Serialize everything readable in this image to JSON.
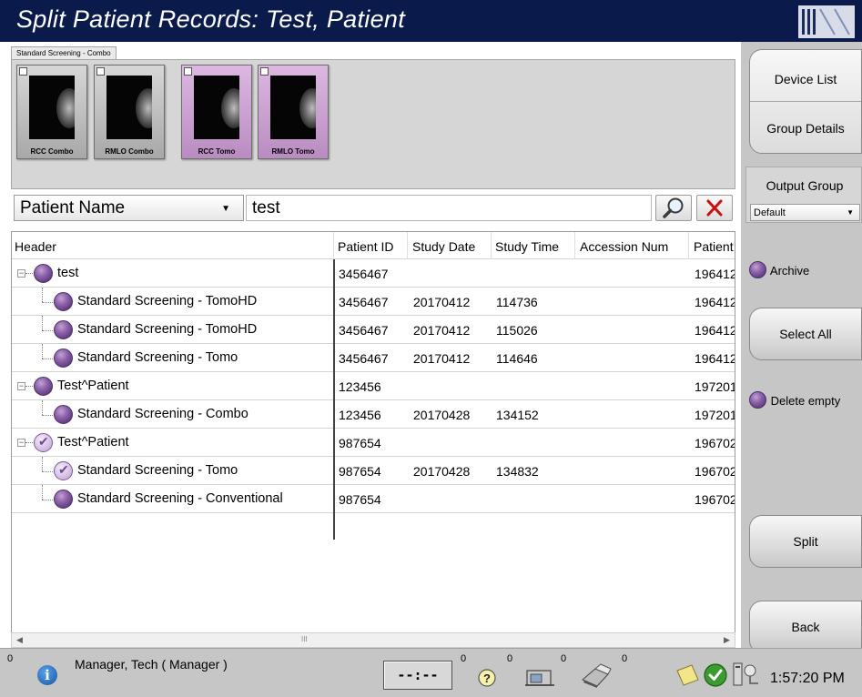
{
  "title": "Split Patient Records: Test, Patient",
  "thumbnails": {
    "tab_label": "Standard Screening - Combo",
    "items": [
      {
        "label": "RCC Combo",
        "selected": false
      },
      {
        "label": "RMLO Combo",
        "selected": false
      },
      {
        "label": "RCC Tomo",
        "selected": true
      },
      {
        "label": "RMLO Tomo",
        "selected": true
      }
    ]
  },
  "search": {
    "field": "Patient Name",
    "value": "test"
  },
  "table": {
    "columns": [
      "Header",
      "Patient ID",
      "Study Date",
      "Study Time",
      "Accession Num",
      "Patient"
    ],
    "rows": [
      {
        "level": 0,
        "name": "test",
        "checked": false,
        "patient_id": "3456467",
        "study_date": "",
        "study_time": "",
        "accession": "",
        "dob": "196412"
      },
      {
        "level": 1,
        "name": "Standard Screening - TomoHD",
        "checked": false,
        "patient_id": "3456467",
        "study_date": "20170412",
        "study_time": "114736",
        "accession": "",
        "dob": "196412"
      },
      {
        "level": 1,
        "name": "Standard Screening - TomoHD",
        "checked": false,
        "patient_id": "3456467",
        "study_date": "20170412",
        "study_time": "115026",
        "accession": "",
        "dob": "196412"
      },
      {
        "level": 1,
        "name": "Standard Screening - Tomo",
        "checked": false,
        "patient_id": "3456467",
        "study_date": "20170412",
        "study_time": "114646",
        "accession": "",
        "dob": "196412"
      },
      {
        "level": 0,
        "name": "Test^Patient",
        "checked": false,
        "patient_id": "123456",
        "study_date": "",
        "study_time": "",
        "accession": "",
        "dob": "197201"
      },
      {
        "level": 1,
        "name": "Standard Screening - Combo",
        "checked": false,
        "patient_id": "123456",
        "study_date": "20170428",
        "study_time": "134152",
        "accession": "",
        "dob": "197201"
      },
      {
        "level": 0,
        "name": "Test^Patient",
        "checked": true,
        "patient_id": "987654",
        "study_date": "",
        "study_time": "",
        "accession": "",
        "dob": "196702"
      },
      {
        "level": 1,
        "name": "Standard Screening - Tomo",
        "checked": true,
        "patient_id": "987654",
        "study_date": "20170428",
        "study_time": "134832",
        "accession": "",
        "dob": "196702"
      },
      {
        "level": 1,
        "name": "Standard Screening - Conventional",
        "checked": false,
        "patient_id": "987654",
        "study_date": "",
        "study_time": "",
        "accession": "",
        "dob": "196702"
      }
    ]
  },
  "scrollbar": {
    "grip": "III"
  },
  "sidebar": {
    "device_list": "Device List",
    "group_details": "Group Details",
    "output_group_label": "Output Group",
    "output_group_value": "Default",
    "archive": "Archive",
    "select_all": "Select All",
    "delete_empty": "Delete empty",
    "split": "Split",
    "back": "Back"
  },
  "statusbar": {
    "left_count": "0",
    "user": "Manager, Tech ( Manager )",
    "clock": "--:--",
    "count_clock": "0",
    "count_help": "0",
    "count_device": "0",
    "count_printer": "0",
    "time": "1:57:20 PM"
  },
  "colors": {
    "title_bg": "#0a1a4a",
    "orb_purple": "#8e64ad",
    "thumb_selected": "#c9a1cf",
    "clear_red": "#cc1010"
  },
  "icons": [
    "search-icon",
    "clear-icon",
    "info-icon",
    "help-icon",
    "device-icon",
    "printer-icon",
    "notes-icon",
    "ok-check-icon",
    "connection-icon"
  ]
}
